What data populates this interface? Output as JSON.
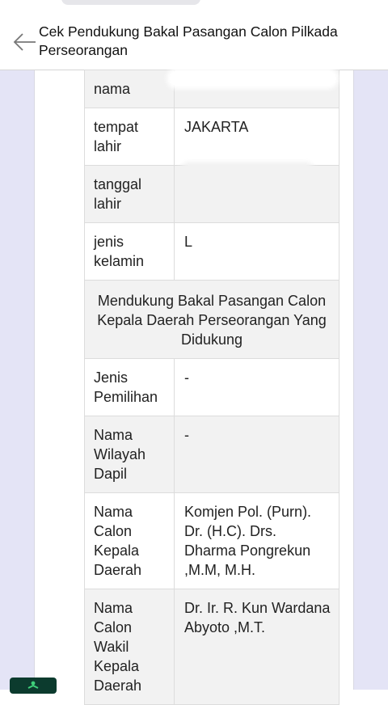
{
  "header": {
    "title": "Cek Pendukung Bakal Pasangan Calon Pilkada Perseorangan",
    "back_icon": "arrow-left-icon"
  },
  "rows": [
    {
      "label": "nama",
      "value": ""
    },
    {
      "label": "tempat lahir",
      "value": "JAKARTA"
    },
    {
      "label": "tanggal lahir",
      "value": ""
    },
    {
      "label": "jenis kelamin",
      "value": "L"
    }
  ],
  "section_heading": "Mendukung Bakal Pasangan Calon Kepala Daerah Perseorangan Yang Didukung",
  "candidate_rows": [
    {
      "label": "Jenis Pemilihan",
      "value": "-"
    },
    {
      "label": "Nama Wilayah Dapil",
      "value": "-"
    },
    {
      "label": "Nama Calon Kepala Daerah",
      "value": "Komjen Pol. (Purn). Dr. (H.C). Drs. Dharma Pongrekun ,M.M, M.H."
    },
    {
      "label": "Nama Calon Wakil Kepala Daerah",
      "value": "Dr. Ir. R. Kun Wardana Abyoto ,M.T."
    }
  ],
  "colors": {
    "page_background": "#e4e4f6",
    "row_shaded": "#f2f2f2",
    "fab_background": "#0c3b2e"
  },
  "fab_icon": "person-icon"
}
